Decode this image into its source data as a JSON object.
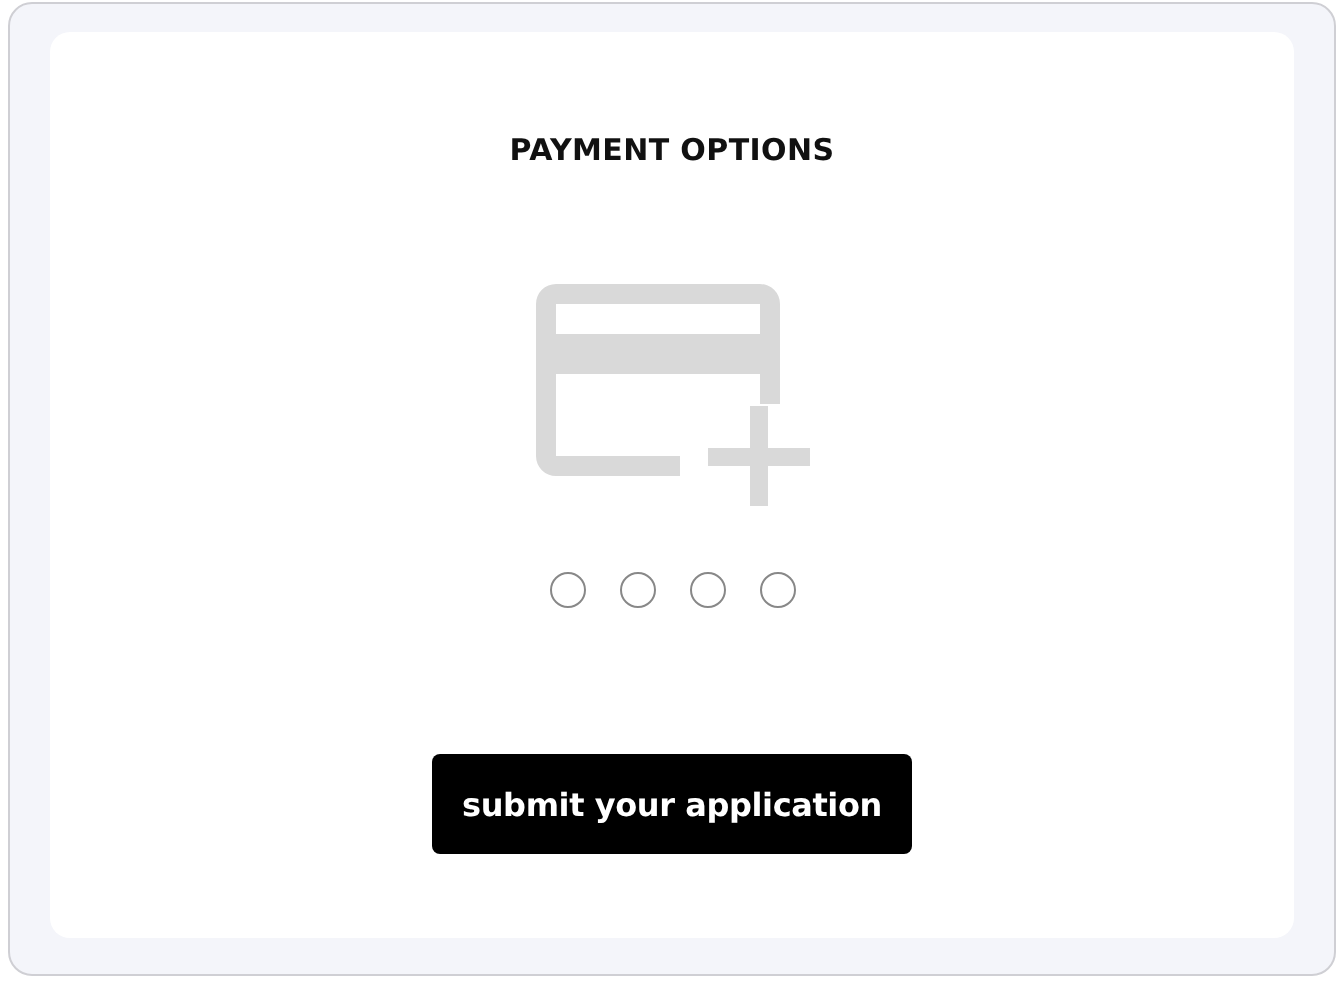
{
  "title": "PAYMENT OPTIONS",
  "options": [
    {
      "selected": false
    },
    {
      "selected": false
    },
    {
      "selected": false
    },
    {
      "selected": false
    }
  ],
  "submit_button": "submit your application"
}
